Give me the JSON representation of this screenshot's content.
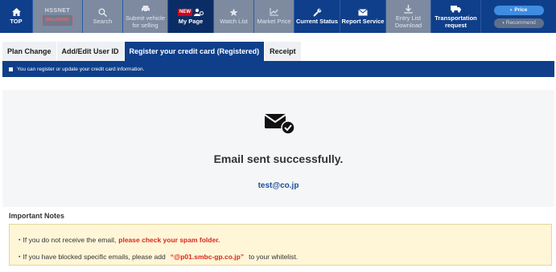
{
  "nav": {
    "top": "TOP",
    "logo_top": "HSSNET",
    "logo_bottom": "MALIGPAK",
    "search": "Search",
    "submit_vehicle": "Submit vehicle for selling",
    "new_badge": "NEW",
    "my_page": "My Page",
    "watch_list": "Watch List",
    "market_price": "Market Price",
    "current_status": "Current Status",
    "report_service": "Report Service",
    "entry_list_download": "Entry List Download",
    "transportation_request": "Transportation request",
    "price": "Price",
    "recommend": "Recommend"
  },
  "tabs": [
    {
      "label": "Plan Change"
    },
    {
      "label": "Add/Edit User ID"
    },
    {
      "label": "Register your credit card (Registered)"
    },
    {
      "label": "Receipt"
    }
  ],
  "info_text": "You can register or update your credit card information.",
  "main": {
    "title": "Email sent successfully.",
    "email": "test@co.jp"
  },
  "notes": {
    "title": "Important Notes",
    "line1_prefix": "・If you do not receive the email,",
    "line1_highlight": "please check your spam folder.",
    "line2_prefix": "・If you have blocked specific emails, please add",
    "line2_highlight": "“@p01.smbc-gp.co.jp”",
    "line2_suffix": "to your whitelist."
  },
  "colors": {
    "nav_bg": "#0f3f8a",
    "highlight_red": "#d9281b",
    "email_blue": "#1f4e99",
    "notes_bg": "#fff6d8"
  },
  "icons": [
    "home-icon",
    "search-icon",
    "car-icon",
    "user-icon",
    "star-icon",
    "chart-icon",
    "wrench-icon",
    "mail-icon",
    "download-icon",
    "truck-icon",
    "mail-check-icon"
  ]
}
